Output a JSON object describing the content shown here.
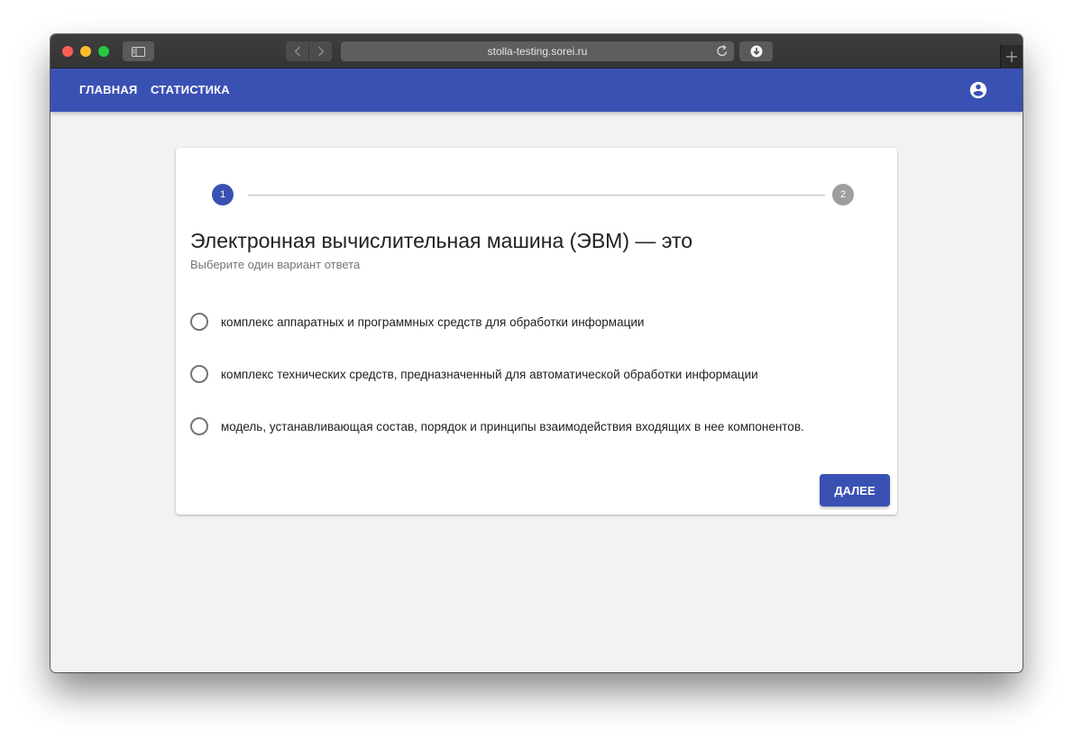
{
  "browser": {
    "address": "stolla-testing.sorei.ru"
  },
  "appbar": {
    "nav": [
      "ГЛАВНАЯ",
      "СТАТИСТИКА"
    ],
    "account_icon": "account-circle-icon"
  },
  "quiz": {
    "steps": [
      "1",
      "2"
    ],
    "current_step": 1,
    "title": "Электронная вычислительная машина (ЭВМ) — это",
    "subtitle": "Выберите один вариант ответа",
    "options": [
      "комплекс аппаратных и программных средств для обработки информации",
      "комплекс технических средств, предназначенный для автоматической обработки информации",
      "модель, устанавливающая состав, порядок и принципы взаимодействия входящих в нее компонентов."
    ],
    "next_label": "ДАЛЕЕ"
  },
  "colors": {
    "primary": "#3a51b4",
    "step_inactive": "#9e9e9e",
    "background": "#f2f2f2"
  }
}
